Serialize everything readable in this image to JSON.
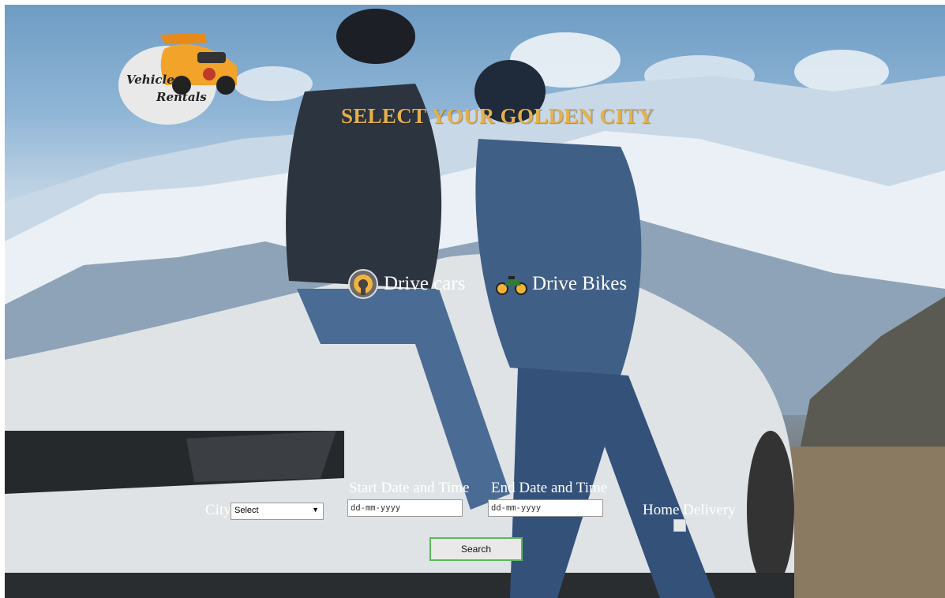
{
  "hero": {
    "title": "SELECT YOUR GOLDEN CITY"
  },
  "logo": {
    "line1": "Vehicle",
    "line2": "Rentals"
  },
  "options": [
    {
      "label": "Drive cars",
      "icon": "steering-wheel-icon"
    },
    {
      "label": "Drive Bikes",
      "icon": "motorbike-icon"
    }
  ],
  "form": {
    "city_label": "City",
    "city_selected": "Select",
    "start_label": "Start Date and Time",
    "start_placeholder": "dd-mm-yyyy",
    "end_label": "End Date and Time",
    "end_placeholder": "dd-mm-yyyy",
    "delivery_label": "Home Delivery",
    "search_label": "Search"
  },
  "colors": {
    "title": "#e6b04a",
    "button_border": "#5cb85c"
  }
}
